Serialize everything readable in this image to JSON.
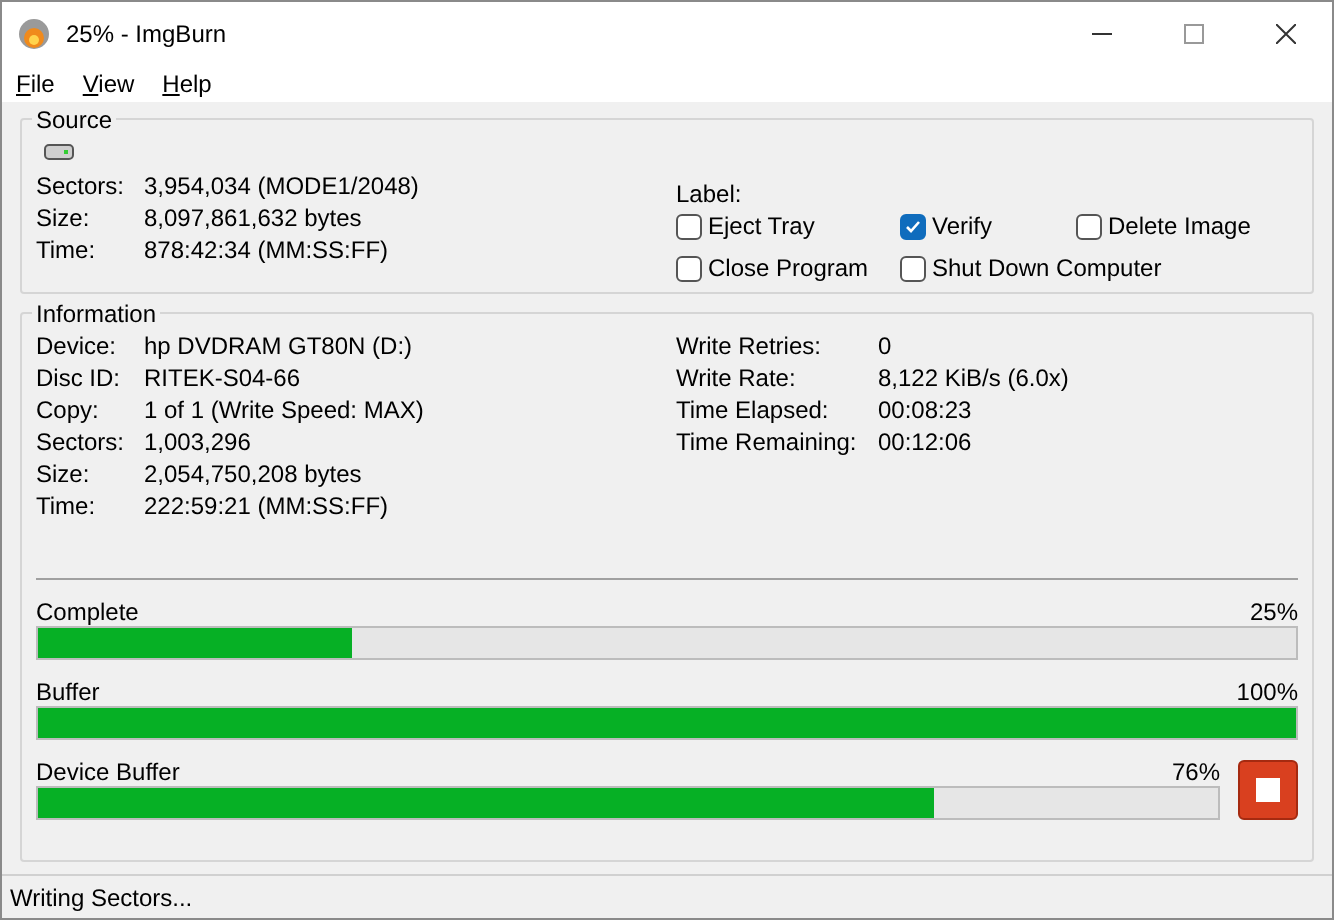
{
  "window": {
    "title": "25% - ImgBurn"
  },
  "menu": [
    {
      "label": "File"
    },
    {
      "label": "View"
    },
    {
      "label": "Help"
    }
  ],
  "source": {
    "title": "Source",
    "fields": [
      {
        "label": "Sectors:",
        "value": "3,954,034 (MODE1/2048)"
      },
      {
        "label": "Size:",
        "value": "8,097,861,632 bytes"
      },
      {
        "label": "Time:",
        "value": "878:42:34 (MM:SS:FF)"
      }
    ],
    "label_caption": "Label:",
    "options": [
      {
        "label": "Eject Tray",
        "checked": false
      },
      {
        "label": "Verify",
        "checked": true
      },
      {
        "label": "Delete Image",
        "checked": false
      },
      {
        "label": "Close Program",
        "checked": false
      },
      {
        "label": "Shut Down Computer",
        "checked": false
      }
    ]
  },
  "information": {
    "title": "Information",
    "left": [
      {
        "label": "Device:",
        "value": "hp DVDRAM GT80N (D:)"
      },
      {
        "label": "Disc ID:",
        "value": "RITEK-S04-66"
      },
      {
        "label": "Copy:",
        "value": "1 of 1 (Write Speed: MAX)"
      },
      {
        "label": "Sectors:",
        "value": "1,003,296"
      },
      {
        "label": "Size:",
        "value": "2,054,750,208 bytes"
      },
      {
        "label": "Time:",
        "value": "222:59:21 (MM:SS:FF)"
      }
    ],
    "right": [
      {
        "label": "Write Retries:",
        "value": "0"
      },
      {
        "label": "Write Rate:",
        "value": "8,122 KiB/s (6.0x)"
      },
      {
        "label": "Time Elapsed:",
        "value": "00:08:23"
      },
      {
        "label": "Time Remaining:",
        "value": "00:12:06"
      }
    ],
    "progress": [
      {
        "label": "Complete",
        "reading": "25%",
        "level": 0.25
      },
      {
        "label": "Buffer",
        "reading": "100%",
        "level": 1.0
      },
      {
        "label": "Device Buffer",
        "reading": "76%",
        "level": 0.76
      }
    ]
  },
  "status_bar": "Writing Sectors..."
}
